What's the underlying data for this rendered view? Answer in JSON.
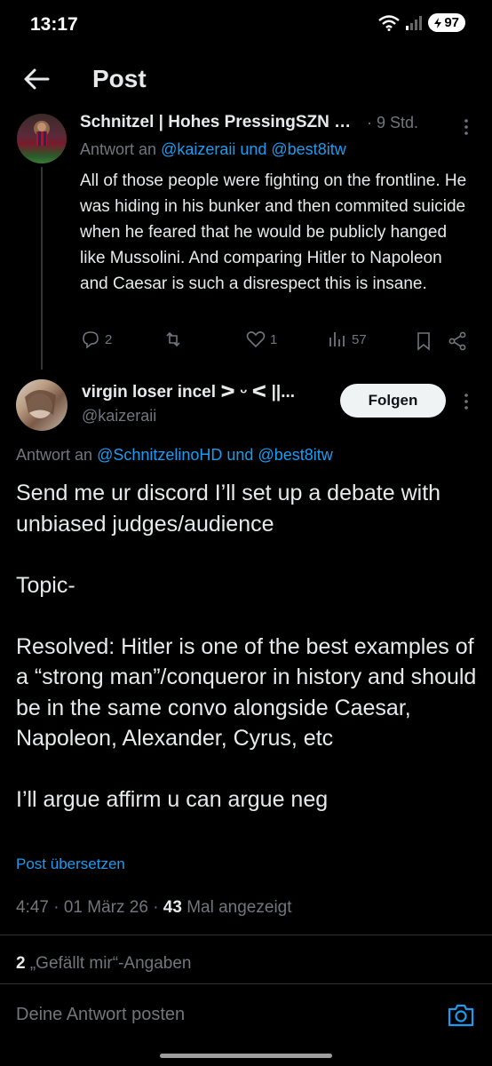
{
  "status": {
    "time": "13:17",
    "battery": "97"
  },
  "header": {
    "title": "Post"
  },
  "parent": {
    "name": "Schnitzel | Hohes PressingSZN …",
    "time": "· 9 Std.",
    "reply_prefix": "Antwort an",
    "reply_users": "@kaizeraii und @best8itw",
    "text": "All of those people were fighting on the frontline. He was hiding in his bunker and then commited suicide when he feared that he would be publicly hanged like Mussolini. And comparing Hitler to Napoleon and Caesar is such a disrespect this is insane.",
    "replies": "2",
    "reposts": "",
    "likes": "1",
    "views": "57"
  },
  "post": {
    "name": "virgin loser incel ᐳ ᵕ ᐸ ||...",
    "handle": "@kaizeraii",
    "follow_label": "Folgen",
    "reply_prefix": "Antwort an",
    "reply_users": "@SchnitzelinoHD und @best8itw",
    "text_lines": [
      "Send me ur discord I’ll set up a debate with unbiased judges/audience",
      "",
      "Topic-",
      "",
      "Resolved: Hitler is one of the best examples of a “strong man”/conqueror in history and should be in the same convo alongside Caesar, Napoleon, Alexander, Cyrus, etc",
      "",
      "I’ll argue affirm u can argue neg"
    ],
    "translate": "Post übersetzen",
    "timestamp": "4:47 · 01 März 26 · ",
    "view_count": "43",
    "view_label": " Mal angezeigt",
    "like_count": "2",
    "like_label": " „Gefällt mir“-Angaben"
  },
  "reply_box": {
    "placeholder": "Deine Antwort posten"
  },
  "colors": {
    "accent": "#1d9bf0",
    "muted": "#71767b",
    "text": "#e7e9ea",
    "background": "#000000"
  }
}
